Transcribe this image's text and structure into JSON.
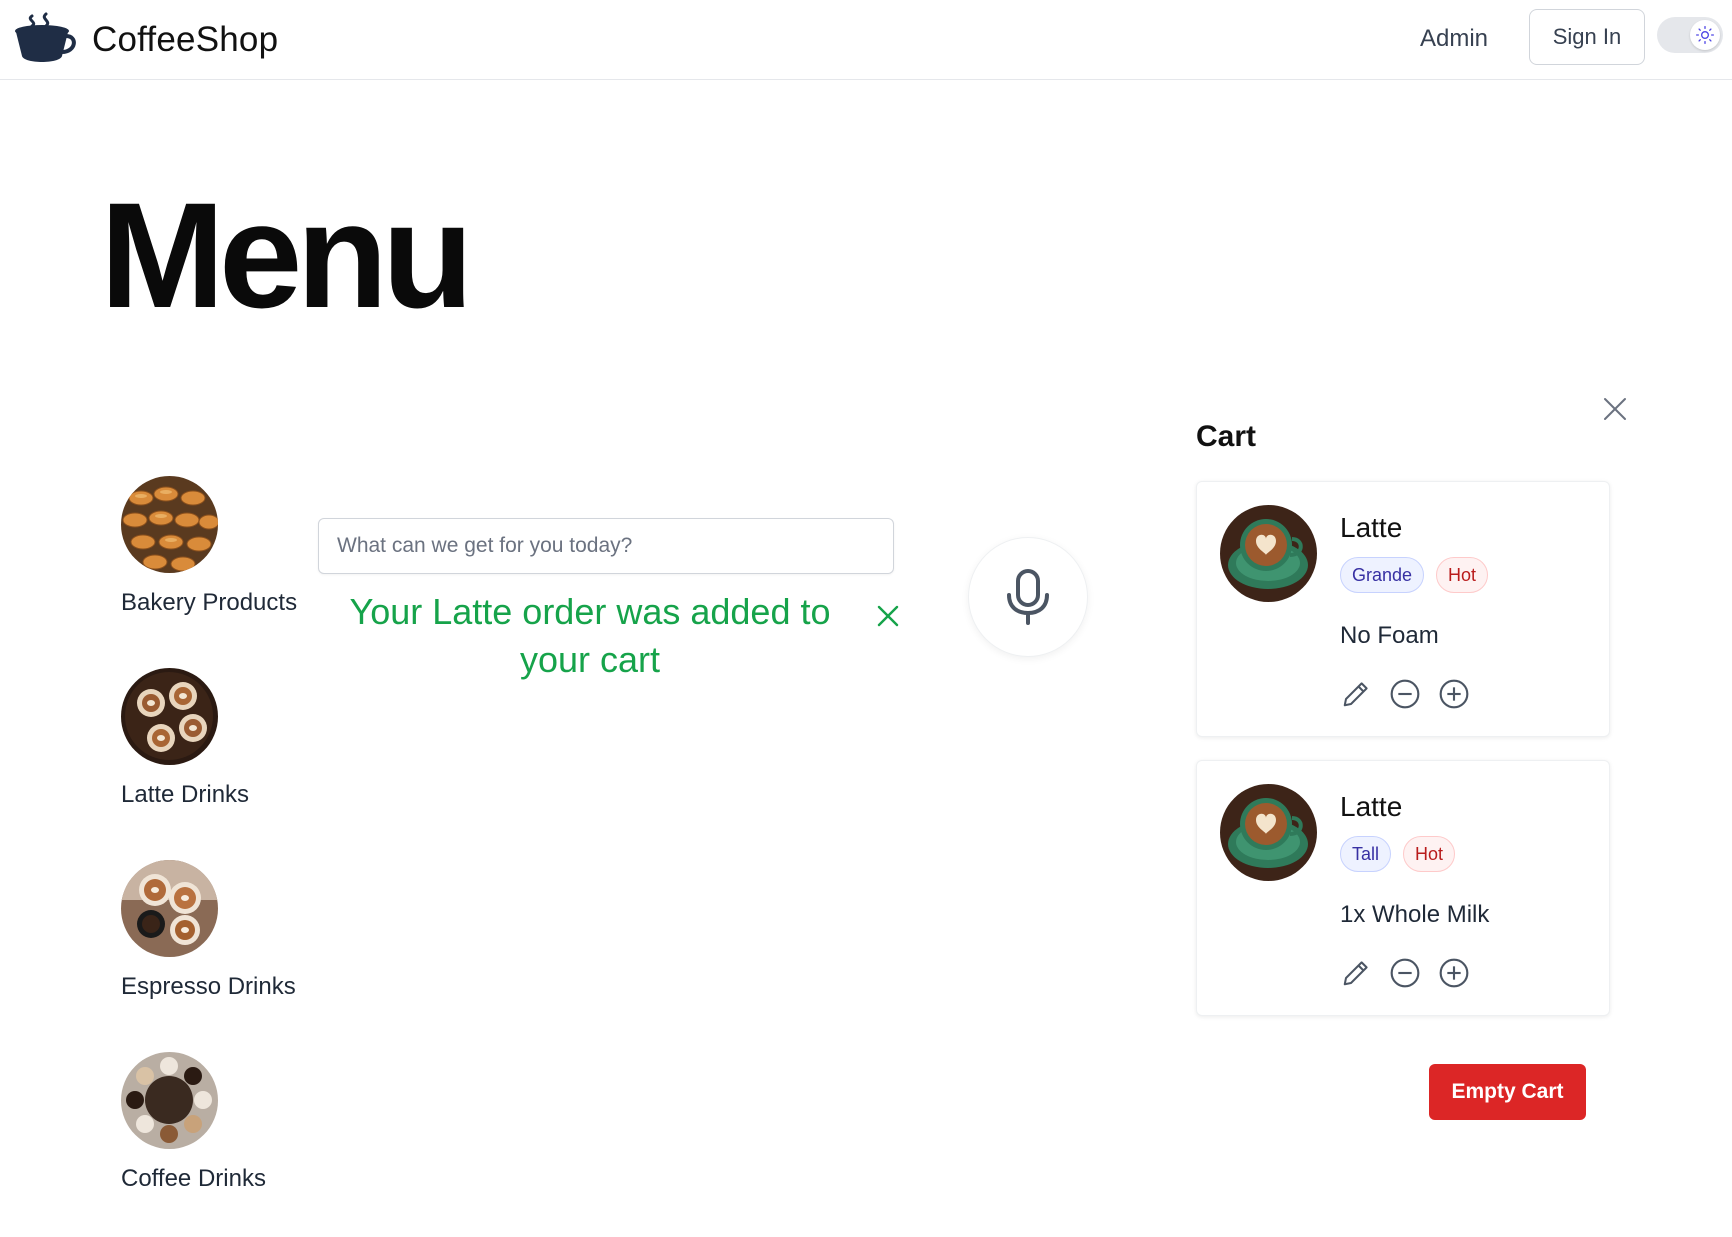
{
  "header": {
    "brand_name": "CoffeeShop",
    "admin_link": "Admin",
    "sign_in_label": "Sign In",
    "theme_icon": "sun-icon"
  },
  "page": {
    "title": "Menu"
  },
  "categories": [
    {
      "label": "Bakery Products",
      "icon": "bakery-image"
    },
    {
      "label": "Latte Drinks",
      "icon": "latte-image"
    },
    {
      "label": "Espresso Drinks",
      "icon": "espresso-image"
    },
    {
      "label": "Coffee Drinks",
      "icon": "coffee-image"
    }
  ],
  "search": {
    "placeholder": "What can we get for you today?",
    "value": ""
  },
  "toast": {
    "message": "Your Latte order was added to your cart",
    "color": "#16a34a"
  },
  "cart": {
    "title": "Cart",
    "items": [
      {
        "name": "Latte",
        "size": "Grande",
        "temperature": "Hot",
        "note": "No Foam"
      },
      {
        "name": "Latte",
        "size": "Tall",
        "temperature": "Hot",
        "note": "1x Whole Milk"
      }
    ],
    "empty_label": "Empty Cart"
  },
  "colors": {
    "accent_red": "#dc2626",
    "success_green": "#16a34a",
    "size_chip": "#3730a3",
    "temp_chip": "#b91c1c"
  }
}
